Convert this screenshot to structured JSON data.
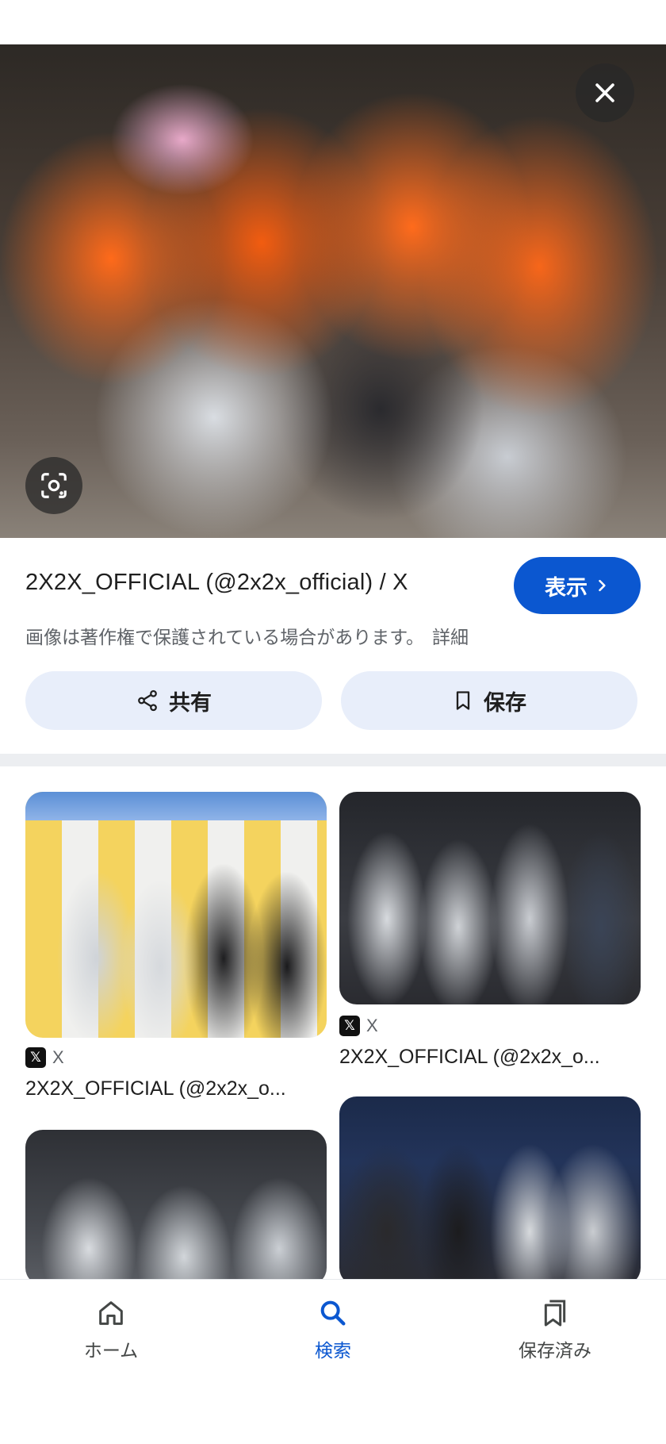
{
  "hero": {
    "close_icon": "close-icon",
    "lens_icon": "google-lens-icon"
  },
  "result": {
    "title": "2X2X_OFFICIAL (@2x2x_official) / X",
    "visit_label": "表示",
    "copyright_text": "画像は著作権で保護されている場合があります。",
    "details_label": "詳細",
    "share_label": "共有",
    "save_label": "保存"
  },
  "related": [
    {
      "source": "X",
      "caption": "2X2X_OFFICIAL (@2x2x_o..."
    },
    {
      "source": "X",
      "caption": "2X2X_OFFICIAL (@2x2x_o..."
    }
  ],
  "bottom_nav": [
    {
      "label": "ホーム",
      "icon": "home-icon"
    },
    {
      "label": "検索",
      "icon": "search-icon",
      "active": true
    },
    {
      "label": "保存済み",
      "icon": "saved-collections-icon"
    }
  ],
  "colors": {
    "accent": "#0b57d0",
    "pill_bg": "#e8eefa",
    "secondary_text": "#5f6368"
  }
}
